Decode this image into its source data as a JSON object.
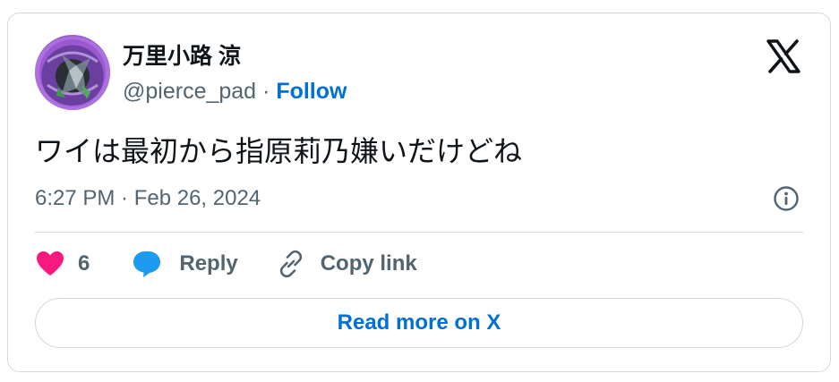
{
  "author": {
    "display_name": "万里小路 涼",
    "handle": "@pierce_pad",
    "separator": " · ",
    "follow_label": "Follow"
  },
  "tweet": {
    "text": "ワイは最初から指原莉乃嫌いだけどね",
    "timestamp": "6:27 PM · Feb 26, 2024"
  },
  "actions": {
    "like_count": "6",
    "reply_label": "Reply",
    "copy_label": "Copy link"
  },
  "read_more_label": "Read more on X",
  "icons": {
    "brand": "x-logo-icon",
    "info": "info-icon",
    "like": "heart-icon",
    "reply": "speech-bubble-icon",
    "copy": "link-icon"
  },
  "colors": {
    "accent": "#006fd6",
    "like": "#f91880",
    "reply": "#1d9bf0",
    "muted": "#536471",
    "text": "#0f1419",
    "border": "#cfd9de"
  }
}
